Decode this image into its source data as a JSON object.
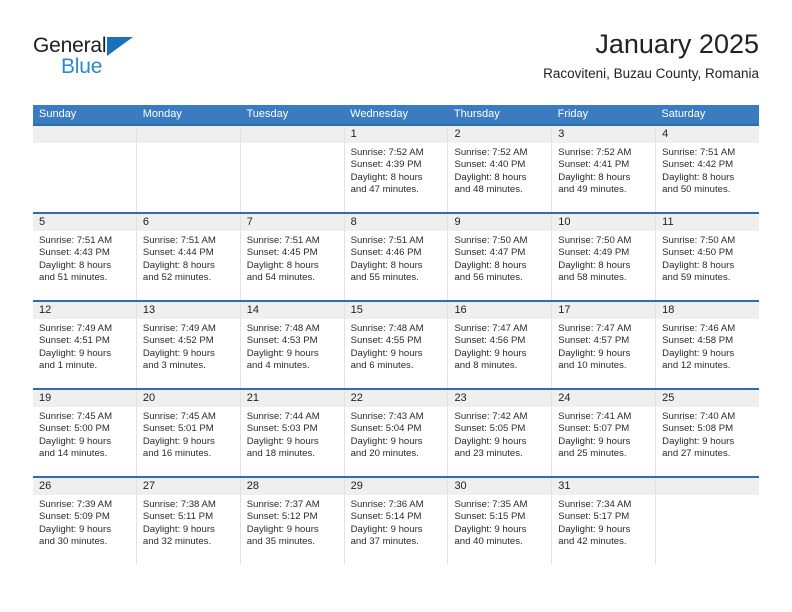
{
  "brand": {
    "name_part1": "General",
    "name_part2": "Blue"
  },
  "header": {
    "title": "January 2025",
    "subtitle": "Racoviteni, Buzau County, Romania"
  },
  "theme": {
    "header_blue": "#3b7cc0",
    "row_divider_blue": "#2d6fae",
    "daynum_gray": "#efefef",
    "logo_blue": "#2a8ad4"
  },
  "weekdays": [
    "Sunday",
    "Monday",
    "Tuesday",
    "Wednesday",
    "Thursday",
    "Friday",
    "Saturday"
  ],
  "weeks": [
    [
      {
        "day": "",
        "sunrise": "",
        "sunset": "",
        "daylight1": "",
        "daylight2": ""
      },
      {
        "day": "",
        "sunrise": "",
        "sunset": "",
        "daylight1": "",
        "daylight2": ""
      },
      {
        "day": "",
        "sunrise": "",
        "sunset": "",
        "daylight1": "",
        "daylight2": ""
      },
      {
        "day": "1",
        "sunrise": "Sunrise: 7:52 AM",
        "sunset": "Sunset: 4:39 PM",
        "daylight1": "Daylight: 8 hours",
        "daylight2": "and 47 minutes."
      },
      {
        "day": "2",
        "sunrise": "Sunrise: 7:52 AM",
        "sunset": "Sunset: 4:40 PM",
        "daylight1": "Daylight: 8 hours",
        "daylight2": "and 48 minutes."
      },
      {
        "day": "3",
        "sunrise": "Sunrise: 7:52 AM",
        "sunset": "Sunset: 4:41 PM",
        "daylight1": "Daylight: 8 hours",
        "daylight2": "and 49 minutes."
      },
      {
        "day": "4",
        "sunrise": "Sunrise: 7:51 AM",
        "sunset": "Sunset: 4:42 PM",
        "daylight1": "Daylight: 8 hours",
        "daylight2": "and 50 minutes."
      }
    ],
    [
      {
        "day": "5",
        "sunrise": "Sunrise: 7:51 AM",
        "sunset": "Sunset: 4:43 PM",
        "daylight1": "Daylight: 8 hours",
        "daylight2": "and 51 minutes."
      },
      {
        "day": "6",
        "sunrise": "Sunrise: 7:51 AM",
        "sunset": "Sunset: 4:44 PM",
        "daylight1": "Daylight: 8 hours",
        "daylight2": "and 52 minutes."
      },
      {
        "day": "7",
        "sunrise": "Sunrise: 7:51 AM",
        "sunset": "Sunset: 4:45 PM",
        "daylight1": "Daylight: 8 hours",
        "daylight2": "and 54 minutes."
      },
      {
        "day": "8",
        "sunrise": "Sunrise: 7:51 AM",
        "sunset": "Sunset: 4:46 PM",
        "daylight1": "Daylight: 8 hours",
        "daylight2": "and 55 minutes."
      },
      {
        "day": "9",
        "sunrise": "Sunrise: 7:50 AM",
        "sunset": "Sunset: 4:47 PM",
        "daylight1": "Daylight: 8 hours",
        "daylight2": "and 56 minutes."
      },
      {
        "day": "10",
        "sunrise": "Sunrise: 7:50 AM",
        "sunset": "Sunset: 4:49 PM",
        "daylight1": "Daylight: 8 hours",
        "daylight2": "and 58 minutes."
      },
      {
        "day": "11",
        "sunrise": "Sunrise: 7:50 AM",
        "sunset": "Sunset: 4:50 PM",
        "daylight1": "Daylight: 8 hours",
        "daylight2": "and 59 minutes."
      }
    ],
    [
      {
        "day": "12",
        "sunrise": "Sunrise: 7:49 AM",
        "sunset": "Sunset: 4:51 PM",
        "daylight1": "Daylight: 9 hours",
        "daylight2": "and 1 minute."
      },
      {
        "day": "13",
        "sunrise": "Sunrise: 7:49 AM",
        "sunset": "Sunset: 4:52 PM",
        "daylight1": "Daylight: 9 hours",
        "daylight2": "and 3 minutes."
      },
      {
        "day": "14",
        "sunrise": "Sunrise: 7:48 AM",
        "sunset": "Sunset: 4:53 PM",
        "daylight1": "Daylight: 9 hours",
        "daylight2": "and 4 minutes."
      },
      {
        "day": "15",
        "sunrise": "Sunrise: 7:48 AM",
        "sunset": "Sunset: 4:55 PM",
        "daylight1": "Daylight: 9 hours",
        "daylight2": "and 6 minutes."
      },
      {
        "day": "16",
        "sunrise": "Sunrise: 7:47 AM",
        "sunset": "Sunset: 4:56 PM",
        "daylight1": "Daylight: 9 hours",
        "daylight2": "and 8 minutes."
      },
      {
        "day": "17",
        "sunrise": "Sunrise: 7:47 AM",
        "sunset": "Sunset: 4:57 PM",
        "daylight1": "Daylight: 9 hours",
        "daylight2": "and 10 minutes."
      },
      {
        "day": "18",
        "sunrise": "Sunrise: 7:46 AM",
        "sunset": "Sunset: 4:58 PM",
        "daylight1": "Daylight: 9 hours",
        "daylight2": "and 12 minutes."
      }
    ],
    [
      {
        "day": "19",
        "sunrise": "Sunrise: 7:45 AM",
        "sunset": "Sunset: 5:00 PM",
        "daylight1": "Daylight: 9 hours",
        "daylight2": "and 14 minutes."
      },
      {
        "day": "20",
        "sunrise": "Sunrise: 7:45 AM",
        "sunset": "Sunset: 5:01 PM",
        "daylight1": "Daylight: 9 hours",
        "daylight2": "and 16 minutes."
      },
      {
        "day": "21",
        "sunrise": "Sunrise: 7:44 AM",
        "sunset": "Sunset: 5:03 PM",
        "daylight1": "Daylight: 9 hours",
        "daylight2": "and 18 minutes."
      },
      {
        "day": "22",
        "sunrise": "Sunrise: 7:43 AM",
        "sunset": "Sunset: 5:04 PM",
        "daylight1": "Daylight: 9 hours",
        "daylight2": "and 20 minutes."
      },
      {
        "day": "23",
        "sunrise": "Sunrise: 7:42 AM",
        "sunset": "Sunset: 5:05 PM",
        "daylight1": "Daylight: 9 hours",
        "daylight2": "and 23 minutes."
      },
      {
        "day": "24",
        "sunrise": "Sunrise: 7:41 AM",
        "sunset": "Sunset: 5:07 PM",
        "daylight1": "Daylight: 9 hours",
        "daylight2": "and 25 minutes."
      },
      {
        "day": "25",
        "sunrise": "Sunrise: 7:40 AM",
        "sunset": "Sunset: 5:08 PM",
        "daylight1": "Daylight: 9 hours",
        "daylight2": "and 27 minutes."
      }
    ],
    [
      {
        "day": "26",
        "sunrise": "Sunrise: 7:39 AM",
        "sunset": "Sunset: 5:09 PM",
        "daylight1": "Daylight: 9 hours",
        "daylight2": "and 30 minutes."
      },
      {
        "day": "27",
        "sunrise": "Sunrise: 7:38 AM",
        "sunset": "Sunset: 5:11 PM",
        "daylight1": "Daylight: 9 hours",
        "daylight2": "and 32 minutes."
      },
      {
        "day": "28",
        "sunrise": "Sunrise: 7:37 AM",
        "sunset": "Sunset: 5:12 PM",
        "daylight1": "Daylight: 9 hours",
        "daylight2": "and 35 minutes."
      },
      {
        "day": "29",
        "sunrise": "Sunrise: 7:36 AM",
        "sunset": "Sunset: 5:14 PM",
        "daylight1": "Daylight: 9 hours",
        "daylight2": "and 37 minutes."
      },
      {
        "day": "30",
        "sunrise": "Sunrise: 7:35 AM",
        "sunset": "Sunset: 5:15 PM",
        "daylight1": "Daylight: 9 hours",
        "daylight2": "and 40 minutes."
      },
      {
        "day": "31",
        "sunrise": "Sunrise: 7:34 AM",
        "sunset": "Sunset: 5:17 PM",
        "daylight1": "Daylight: 9 hours",
        "daylight2": "and 42 minutes."
      },
      {
        "day": "",
        "sunrise": "",
        "sunset": "",
        "daylight1": "",
        "daylight2": ""
      }
    ]
  ]
}
